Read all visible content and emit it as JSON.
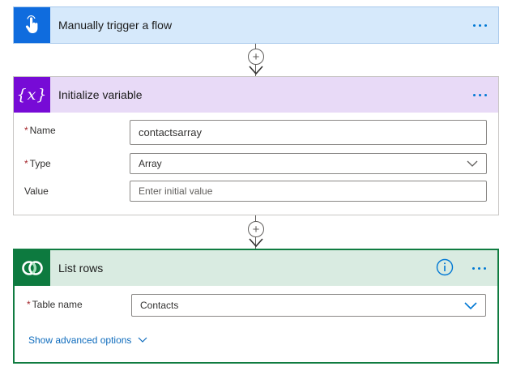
{
  "trigger": {
    "title": "Manually trigger a flow",
    "icon": "touch-hand-icon"
  },
  "init_variable": {
    "title": "Initialize variable",
    "icon": "variable-braces-icon",
    "icon_text": "{x}",
    "fields": {
      "name_label": "Name",
      "name_value": "contactsarray",
      "type_label": "Type",
      "type_value": "Array",
      "value_label": "Value",
      "value_placeholder": "Enter initial value"
    }
  },
  "list_rows": {
    "title": "List rows",
    "icon": "dataverse-icon",
    "fields": {
      "table_label": "Table name",
      "table_value": "Contacts"
    },
    "advanced_link": "Show advanced options"
  },
  "colors": {
    "accent": "#0078d4",
    "trigger_blue": "#0f6cde",
    "variable_purple": "#770bd6",
    "dataverse_green": "#107c41",
    "required_red": "#a4262c"
  }
}
